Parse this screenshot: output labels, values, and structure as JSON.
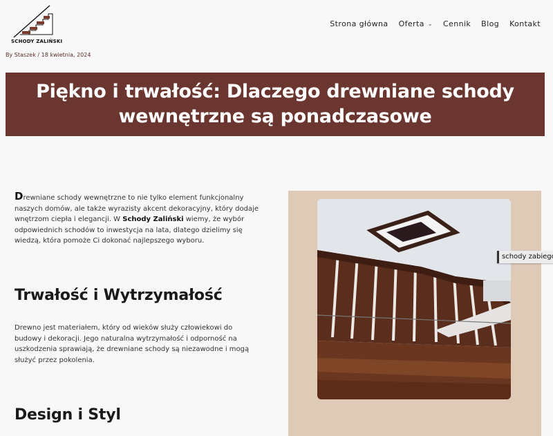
{
  "brand": {
    "name": "SCHODY ZALIŃSKI",
    "logo_icon": "stairs-logo-icon"
  },
  "nav": {
    "items": [
      {
        "label": "Strona główna"
      },
      {
        "label": "Oferta",
        "has_dropdown": true
      },
      {
        "label": "Cennik"
      },
      {
        "label": "Blog"
      },
      {
        "label": "Kontakt"
      }
    ]
  },
  "post_meta": {
    "prefix": "By",
    "author": "Staszek",
    "separator": "/",
    "date": "18 kwietnia, 2024"
  },
  "hero": {
    "title": "Piękno i trwałość: Dlaczego drewniane schody wewnętrzne są ponadczasowe"
  },
  "intro": {
    "dropcap": "D",
    "text_before": "rewniane schody wewnętrzne to nie tylko element funkcjonalny naszych domów, ale także wyrazisty akcent dekoracyjny, który dodaje wnętrzom ciepła i elegancji. W ",
    "brand_strong": "Schody Zaliński",
    "text_after": " wiemy, że wybór odpowiednich schodów to inwestycja na lata, dlatego dzielimy się wiedzą, która pomoże Ci dokonać najlepszego wyboru."
  },
  "sections": [
    {
      "heading": "Trwałość i Wytrzymałość",
      "body": "Drewno jest materiałem, który od wieków służy człowiekowi do budowy i dekoracji. Jego naturalna wytrzymałość i odporność na uszkodzenia sprawiają, że drewniane schody są niezawodne i mogą służyć przez pokolenia."
    },
    {
      "heading": "Design i Styl"
    }
  ],
  "image": {
    "tooltip": "schody zabiegowe"
  },
  "colors": {
    "hero_bg": "#6b3530",
    "media_bg": "#dfcab8",
    "meta_text": "#5a2e27"
  }
}
